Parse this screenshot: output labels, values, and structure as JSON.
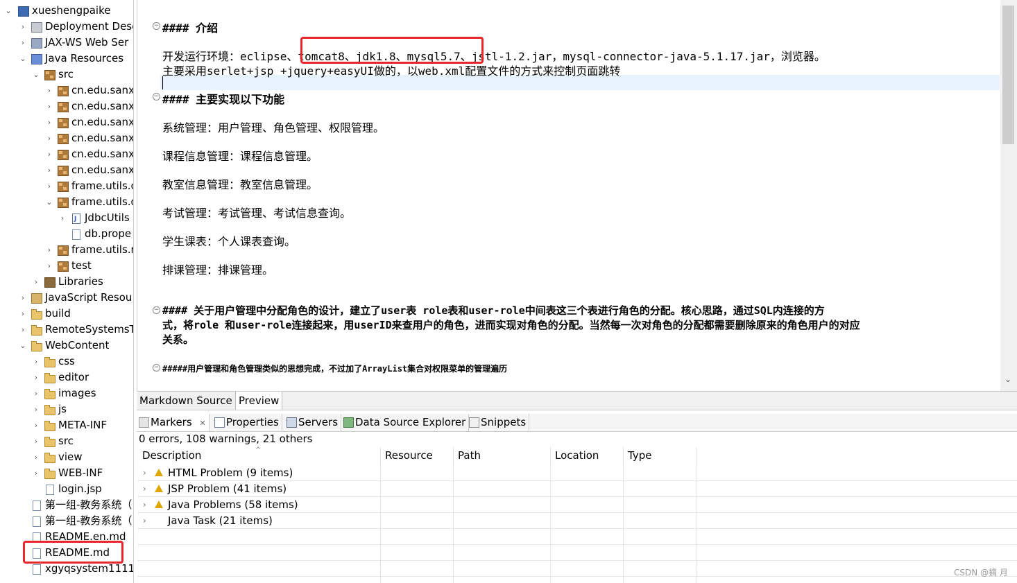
{
  "explorer": {
    "items": [
      {
        "label": "xueshengpaike",
        "icon": "project-icon"
      },
      {
        "label": "Deployment Desc",
        "icon": "deployment-descriptor-icon"
      },
      {
        "label": "JAX-WS Web Ser",
        "icon": "web-services-icon"
      },
      {
        "label": "Java Resources",
        "icon": "java-resources-icon"
      },
      {
        "label": "src",
        "icon": "source-folder-icon"
      },
      {
        "label": "cn.edu.sanx",
        "icon": "package-icon"
      },
      {
        "label": "cn.edu.sanx",
        "icon": "package-icon"
      },
      {
        "label": "cn.edu.sanx",
        "icon": "package-icon"
      },
      {
        "label": "cn.edu.sanx",
        "icon": "package-icon"
      },
      {
        "label": "cn.edu.sanx",
        "icon": "package-icon"
      },
      {
        "label": "cn.edu.sanx",
        "icon": "package-icon"
      },
      {
        "label": "frame.utils.c",
        "icon": "package-icon"
      },
      {
        "label": "frame.utils.d",
        "icon": "package-icon"
      },
      {
        "label": "JdbcUtils",
        "icon": "java-file-icon"
      },
      {
        "label": "db.prope",
        "icon": "file-icon"
      },
      {
        "label": "frame.utils.r",
        "icon": "package-icon"
      },
      {
        "label": "test",
        "icon": "package-icon"
      },
      {
        "label": "Libraries",
        "icon": "libraries-icon"
      },
      {
        "label": "JavaScript Resou",
        "icon": "javascript-resources-icon"
      },
      {
        "label": "build",
        "icon": "folder-icon"
      },
      {
        "label": "RemoteSystemsT",
        "icon": "folder-icon"
      },
      {
        "label": "WebContent",
        "icon": "folder-icon"
      },
      {
        "label": "css",
        "icon": "folder-icon"
      },
      {
        "label": "editor",
        "icon": "folder-icon"
      },
      {
        "label": "images",
        "icon": "folder-icon"
      },
      {
        "label": "js",
        "icon": "folder-icon"
      },
      {
        "label": "META-INF",
        "icon": "folder-icon"
      },
      {
        "label": "src",
        "icon": "folder-icon"
      },
      {
        "label": "view",
        "icon": "folder-icon"
      },
      {
        "label": "WEB-INF",
        "icon": "folder-icon"
      },
      {
        "label": "login.jsp",
        "icon": "file-icon"
      },
      {
        "label": "第一组-教务系统（",
        "icon": "file-icon"
      },
      {
        "label": "第一组-教务系统（",
        "icon": "file-icon"
      },
      {
        "label": "README.en.md",
        "icon": "markdown-file-icon"
      },
      {
        "label": "README.md",
        "icon": "markdown-file-icon"
      },
      {
        "label": "xgyqsystem1111",
        "icon": "file-icon"
      }
    ]
  },
  "editor": {
    "lines": {
      "h_intro": "#### 介绍",
      "env": "开发运行环境：eclipse、tomcat8、jdk1.8、mysql5.7、jstl-1.2.jar，mysql-connector-java-5.1.17.jar，浏览器。",
      "main_use": "主要采用serlet+jsp +jquery+easyUI做的，以web.xml配置文件的方式来控制页面跳转",
      "h_features": "####  主要实现以下功能",
      "f1": "系统管理：用户管理、角色管理、权限管理。",
      "f2": "课程信息管理：课程信息管理。",
      "f3": "教室信息管理：教室信息管理。",
      "f4": "考试管理：考试管理、考试信息查询。",
      "f5": "学生课表：个人课表查询。",
      "f6": "排课管理：排课管理。",
      "h_roles_1": "#### 关于用户管理中分配角色的设计，建立了user表 role表和user-role中间表这三个表进行角色的分配。核心思路，通过SQL内连接的方",
      "h_roles_2": "式，将role 和user-role连接起来，用userID来查用户的角色，进而实现对角色的分配。当然每一次对角色的分配都需要删除原来的角色用户的对应",
      "h_roles_3": "关系。",
      "h_perm": "#####用户管理和角色管理类似的思想完成，不过加了ArrayList集合对权限菜单的管理遍历"
    },
    "tabs": {
      "source": "Markdown Source",
      "preview": "Preview"
    }
  },
  "views": {
    "tabs": {
      "markers": "Markers",
      "properties": "Properties",
      "servers": "Servers",
      "data_source": "Data Source Explorer",
      "snippets": "Snippets"
    },
    "close_glyph": "✕",
    "summary": "0 errors, 108 warnings, 21 others",
    "columns": {
      "description": "Description",
      "resource": "Resource",
      "path": "Path",
      "location": "Location",
      "type": "Type"
    },
    "rows": [
      {
        "label": "HTML Problem (9 items)",
        "severity": "warning"
      },
      {
        "label": "JSP Problem (41 items)",
        "severity": "warning"
      },
      {
        "label": "Java Problems (58 items)",
        "severity": "warning"
      },
      {
        "label": "Java Task (21 items)",
        "severity": "task"
      }
    ]
  },
  "watermark": "CSDN @摘 月",
  "colors": {
    "highlight_box": "#e8262b",
    "current_line": "#e8f2fe",
    "warning": "#e0a600"
  }
}
